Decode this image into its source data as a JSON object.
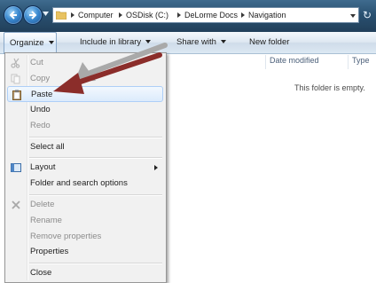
{
  "address_bar": {
    "crumbs": [
      "Computer",
      "OSDisk (C:)",
      "DeLorme Docs",
      "Navigation"
    ]
  },
  "command_bar": {
    "organize": "Organize",
    "include_in_library": "Include in library",
    "share_with": "Share with",
    "new_folder": "New folder"
  },
  "columns": {
    "date_modified": "Date modified",
    "type": "Type"
  },
  "content": {
    "empty_message": "This folder is empty."
  },
  "organize_menu": {
    "items": [
      {
        "label": "Cut",
        "enabled": false,
        "icon": "scissors-icon"
      },
      {
        "label": "Copy",
        "enabled": false,
        "icon": "copy-icon"
      },
      {
        "label": "Paste",
        "enabled": true,
        "icon": "clipboard-icon",
        "highlighted": true
      },
      {
        "label": "Undo",
        "enabled": true
      },
      {
        "label": "Redo",
        "enabled": false
      },
      {
        "label": "Select all",
        "enabled": true
      },
      {
        "label": "Layout",
        "enabled": true,
        "icon": "layout-icon",
        "submenu": true
      },
      {
        "label": "Folder and search options",
        "enabled": true
      },
      {
        "label": "Delete",
        "enabled": false,
        "icon": "delete-x-icon"
      },
      {
        "label": "Rename",
        "enabled": false
      },
      {
        "label": "Remove properties",
        "enabled": false
      },
      {
        "label": "Properties",
        "enabled": true
      },
      {
        "label": "Close",
        "enabled": true
      }
    ]
  },
  "colors": {
    "annotation_arrow": "#8b2d2a",
    "annotation_shadow": "#a9a9a9",
    "menu_highlight": "#dcebfc",
    "disabled_text": "#8c8c8c"
  }
}
